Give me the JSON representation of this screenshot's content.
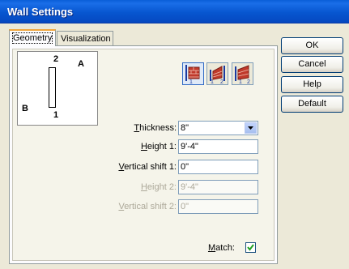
{
  "window": {
    "title": "Wall Settings"
  },
  "tabs": [
    {
      "label": "Geometry",
      "active": true
    },
    {
      "label": "Visualization",
      "active": false
    }
  ],
  "buttons": {
    "ok": "OK",
    "cancel": "Cancel",
    "help": "Help",
    "default": "Default"
  },
  "preview": {
    "label_2": "2",
    "label_a": "A",
    "label_b": "B",
    "label_1": "1"
  },
  "wall_type_icons": [
    {
      "name": "wall-type-1-icon",
      "caption": "1",
      "selected": true
    },
    {
      "name": "wall-type-1-2-icon",
      "caption": "1 2",
      "selected": false
    },
    {
      "name": "wall-type-2-icon",
      "caption": "1 2",
      "selected": false
    }
  ],
  "fields": {
    "thickness": {
      "label_prefix": "T",
      "label_rest": "hickness:",
      "value": "8\""
    },
    "height1": {
      "label_prefix": "H",
      "label_rest": "eight 1:",
      "value": "9'-4\""
    },
    "vshift1": {
      "label_prefix": "V",
      "label_rest": "ertical shift 1:",
      "value": "0\""
    },
    "height2": {
      "label_prefix": "H",
      "label_rest": "eight 2:",
      "value": "9'-4\""
    },
    "vshift2": {
      "label_prefix": "V",
      "label_rest": "ertical shift 2:",
      "value": "0\""
    }
  },
  "match": {
    "label_prefix": "M",
    "label_rest": "atch:",
    "checked": true,
    "mark": "✓"
  },
  "colors": {
    "title_bar": "#0756d0",
    "brick": "#c0392b"
  }
}
